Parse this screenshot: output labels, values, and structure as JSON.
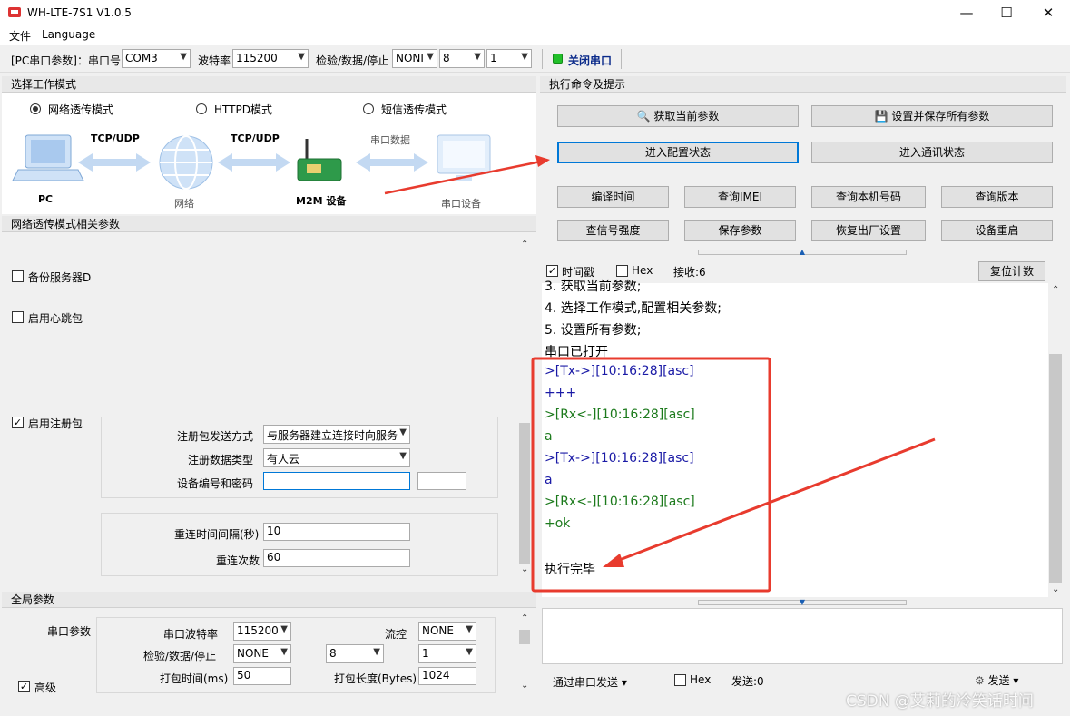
{
  "window": {
    "title": "WH-LTE-7S1 V1.0.5",
    "controls": [
      "—",
      "☐",
      "✕"
    ]
  },
  "menu": {
    "file": "文件",
    "language": "Language"
  },
  "toolbar": {
    "pc_params_label": "[PC串口参数]：串口号",
    "port": "COM3",
    "baud_label": "波特率",
    "baud": "115200",
    "parity_label": "检验/数据/停止",
    "parity": "NONI",
    "databits": "8",
    "stopbits": "1",
    "close_port": "关闭串口",
    "port_status_color": "#22c02a"
  },
  "mode_section": {
    "title": "选择工作模式",
    "modes": [
      "网络透传模式",
      "HTTPD模式",
      "短信透传模式"
    ],
    "selected": 0,
    "diagram": {
      "pc": "PC",
      "link1": "TCP/UDP",
      "network": "网络",
      "link2": "TCP/UDP",
      "m2m": "M2M 设备",
      "link3": "串口数据",
      "serial_device": "串口设备"
    }
  },
  "net_params": {
    "title": "网络透传模式相关参数",
    "backup_server": "备份服务器D",
    "heartbeat": "启用心跳包",
    "register": "启用注册包",
    "register_checked": true,
    "reg_send_label": "注册包发送方式",
    "reg_send_value": "与服务器建立连接时向服务",
    "reg_type_label": "注册数据类型",
    "reg_type_value": "有人云",
    "device_id_label": "设备编号和密码",
    "device_id_value": "",
    "device_pwd_value": "",
    "reconnect_interval_label": "重连时间间隔(秒)",
    "reconnect_interval": "10",
    "reconnect_count_label": "重连次数",
    "reconnect_count": "60"
  },
  "global_params": {
    "title": "全局参数",
    "serial_params_label": "串口参数",
    "advanced": "高级",
    "advanced_checked": true,
    "baud_label": "串口波特率",
    "baud": "115200",
    "flow_label": "流控",
    "flow": "NONE",
    "parity_label": "检验/数据/停止",
    "parity": "NONE",
    "databits": "8",
    "stopbits": "1",
    "pack_time_label": "打包时间(ms)",
    "pack_time": "50",
    "pack_len_label": "打包长度(Bytes)",
    "pack_len": "1024"
  },
  "commands": {
    "title": "执行命令及提示",
    "get_params": "获取当前参数",
    "set_save_all": "设置并保存所有参数",
    "enter_config": "进入配置状态",
    "enter_comm": "进入通讯状态",
    "row3": [
      "编译时间",
      "查询IMEI",
      "查询本机号码",
      "查询版本"
    ],
    "row4": [
      "查信号强度",
      "保存参数",
      "恢复出厂设置",
      "设备重启"
    ]
  },
  "log": {
    "timestamp_label": "时间戳",
    "timestamp_checked": true,
    "hex_label": "Hex",
    "recv_label": "接收:6",
    "reset_count": "复位计数",
    "lines": [
      {
        "text": "3. 获取当前参数;",
        "color": "default"
      },
      {
        "text": "4. 选择工作模式,配置相关参数;",
        "color": "default"
      },
      {
        "text": "5. 设置所有参数;",
        "color": "default"
      },
      {
        "text": "串口已打开",
        "color": "default"
      },
      {
        "text": ">[Tx->][10:16:28][asc]",
        "color": "blue"
      },
      {
        "text": "+++",
        "color": "blue"
      },
      {
        "text": ">[Rx<-][10:16:28][asc]",
        "color": "green"
      },
      {
        "text": "a",
        "color": "green"
      },
      {
        "text": ">[Tx->][10:16:28][asc]",
        "color": "blue"
      },
      {
        "text": "a",
        "color": "blue"
      },
      {
        "text": ">[Rx<-][10:16:28][asc]",
        "color": "green"
      },
      {
        "text": "+ok",
        "color": "green"
      },
      {
        "text": "",
        "color": "default"
      },
      {
        "text": "执行完毕",
        "color": "default"
      }
    ]
  },
  "send_bar": {
    "via_serial": "通过串口发送",
    "hex_label": "Hex",
    "sent_label": "发送:0",
    "send_button": "发送"
  },
  "watermark": "CSDN @艾莉的冷笑话时间",
  "annotation_color": "#e83b2e"
}
